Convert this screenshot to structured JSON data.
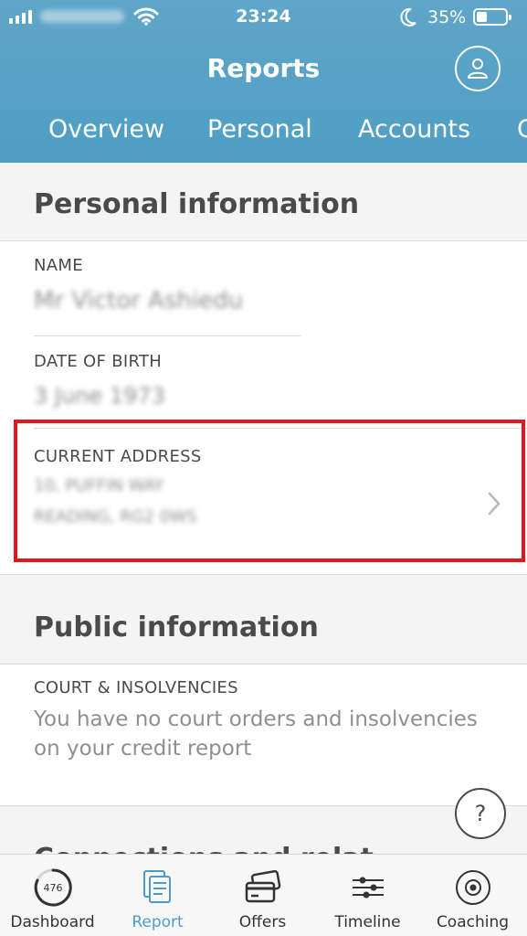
{
  "status_bar": {
    "time": "23:24",
    "battery_percent": "35%",
    "battery_level": 0.35
  },
  "header": {
    "title": "Reports",
    "tabs": [
      {
        "label": "Overview"
      },
      {
        "label": "Personal"
      },
      {
        "label": "Accounts"
      },
      {
        "label": "C"
      }
    ]
  },
  "personal_section": {
    "title": "Personal information",
    "name_label": "NAME",
    "dob_label": "DATE OF BIRTH",
    "address_label": "CURRENT ADDRESS"
  },
  "public_section": {
    "title": "Public information",
    "court_label": "COURT & INSOLVENCIES",
    "court_text": "You have no court orders and insolvencies on your credit report"
  },
  "next_section": {
    "title_partial": "Connections and relat"
  },
  "help_button": "?",
  "bottom_nav": {
    "items": [
      {
        "label": "Dashboard",
        "badge": "476"
      },
      {
        "label": "Report"
      },
      {
        "label": "Offers"
      },
      {
        "label": "Timeline"
      },
      {
        "label": "Coaching"
      }
    ],
    "active": "Report"
  },
  "colors": {
    "header": "#5fa6c8",
    "highlight": "#e5161b",
    "active_nav": "#4d9cc6"
  }
}
